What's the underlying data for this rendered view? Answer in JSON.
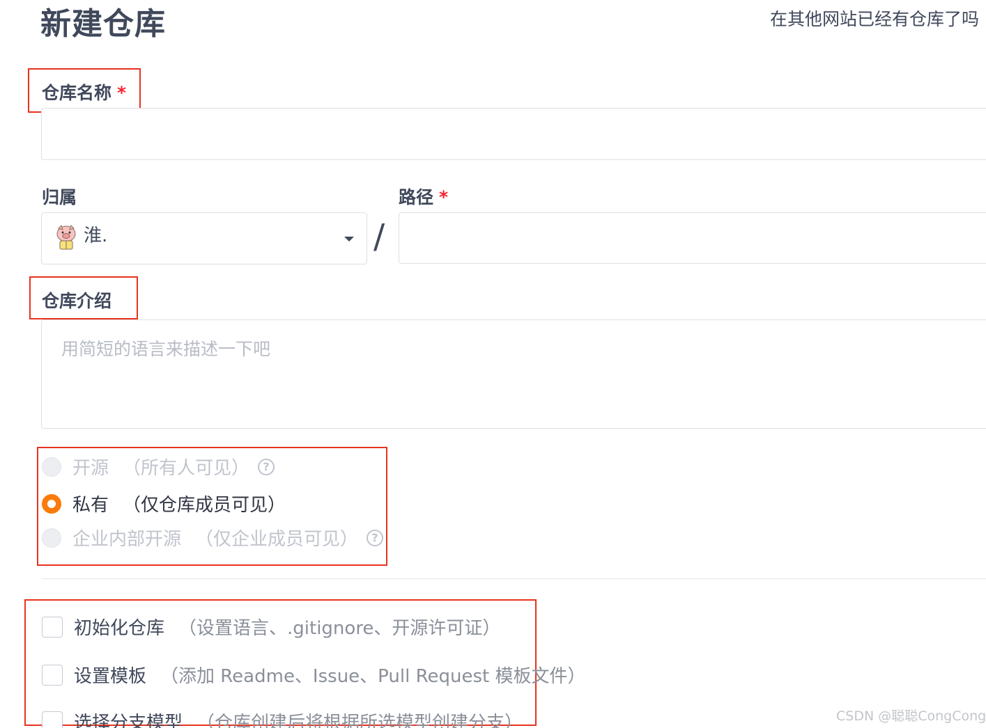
{
  "header": {
    "title": "新建仓库",
    "import_link": "在其他网站已经有仓库了吗"
  },
  "repo_name": {
    "label": "仓库名称",
    "required_mark": "*",
    "value": ""
  },
  "owner": {
    "label": "归属",
    "value": "淮.",
    "avatar_icon": "pig-avatar-icon"
  },
  "path": {
    "label": "路径",
    "required_mark": "*",
    "separator": "/",
    "value": ""
  },
  "description": {
    "label": "仓库介绍",
    "placeholder": "用简短的语言来描述一下吧",
    "value": ""
  },
  "visibility": {
    "options": [
      {
        "label": "开源",
        "hint": "（所有人可见）",
        "help": "?",
        "state": "disabled"
      },
      {
        "label": "私有",
        "hint": "（仅仓库成员可见）",
        "state": "checked"
      },
      {
        "label": "企业内部开源",
        "hint": "（仅企业成员可见）",
        "help": "?",
        "state": "disabled"
      }
    ],
    "accent_color": "#fa7a0a"
  },
  "options": [
    {
      "label": "初始化仓库",
      "hint": "（设置语言、.gitignore、开源许可证）",
      "checked": false
    },
    {
      "label": "设置模板",
      "hint": "（添加 Readme、Issue、Pull Request 模板文件）",
      "checked": false
    },
    {
      "label": "选择分支模型",
      "hint": "（仓库创建后将根据所选模型创建分支）",
      "checked": false
    }
  ],
  "watermark": "CSDN @聪聪CongCong",
  "colors": {
    "annotation_red": "#e8321f",
    "required_red": "#f5222d"
  }
}
